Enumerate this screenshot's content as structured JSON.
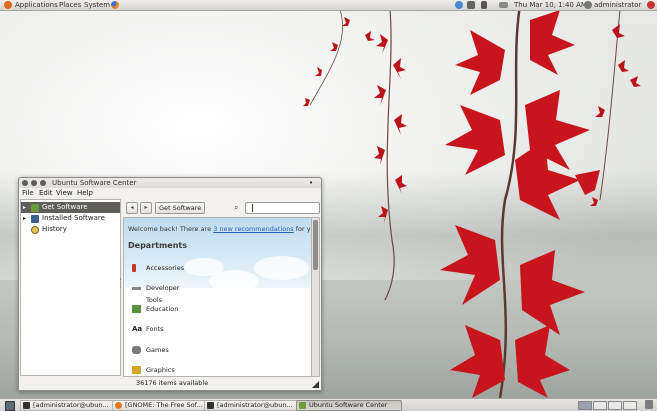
{
  "top_panel": {
    "menus": [
      "Applications",
      "Places",
      "System"
    ],
    "clock": "Thu Mar 10,  1:40 AM",
    "user": "administrator",
    "tray_icons": [
      "network-icon",
      "mail-icon",
      "volume-icon",
      "battery-icon"
    ]
  },
  "window": {
    "title": "Ubuntu Software Center",
    "menu": [
      "File",
      "Edit",
      "View",
      "Help"
    ],
    "sidebar": [
      {
        "label": "Get Software",
        "icon": "get-software-icon",
        "selected": true,
        "expandable": true
      },
      {
        "label": "Installed Software",
        "icon": "installed-software-icon",
        "selected": false,
        "expandable": true
      },
      {
        "label": "History",
        "icon": "history-icon",
        "selected": false,
        "expandable": false
      }
    ],
    "toolbar": {
      "back_label": "◂",
      "forward_label": "▸",
      "breadcrumb": "Get Software",
      "search_value": ""
    },
    "welcome": {
      "prefix": "Welcome back! There are ",
      "link": "3 new recommendations",
      "suffix": " for y"
    },
    "departments_title": "Departments",
    "departments": [
      {
        "label": "Accessories",
        "icon": "accessories-icon"
      },
      {
        "label": "Developer Tools",
        "icon": "developer-tools-icon"
      },
      {
        "label": "Education",
        "icon": "education-icon"
      },
      {
        "label": "Fonts",
        "icon": "fonts-icon"
      },
      {
        "label": "Games",
        "icon": "games-icon"
      },
      {
        "label": "Graphics",
        "icon": "graphics-icon"
      }
    ],
    "status": "36176 items available"
  },
  "taskbar": {
    "tasks": [
      {
        "label": "[administrator@ubun...",
        "active": false
      },
      {
        "label": "[GNOME: The Free Sof...",
        "active": false
      },
      {
        "label": "[administrator@ubun...",
        "active": false
      },
      {
        "label": "Ubuntu Software Center",
        "active": true
      }
    ]
  },
  "colors": {
    "accent_selected": "#5f5e5a",
    "link": "#2a5fb8",
    "leaf_red": "#c8141c"
  }
}
